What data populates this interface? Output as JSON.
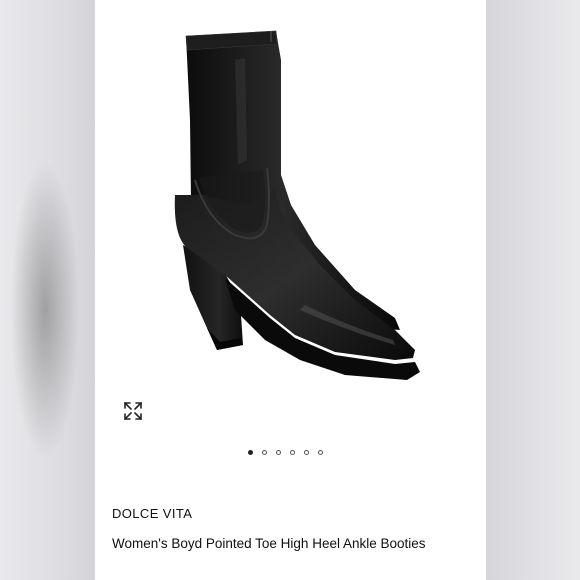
{
  "product": {
    "brand": "DOLCE VITA",
    "title": "Women's Boyd Pointed Toe High Heel Ankle Booties"
  },
  "gallery": {
    "image_count": 6,
    "active_index": 0,
    "expand_icon": "expand-arrows-icon"
  },
  "colors": {
    "background_blur": "#d9d9dc",
    "panel": "#ffffff",
    "text": "#111111",
    "boot": "#141414",
    "scrollbar": "#8a8a8a"
  }
}
